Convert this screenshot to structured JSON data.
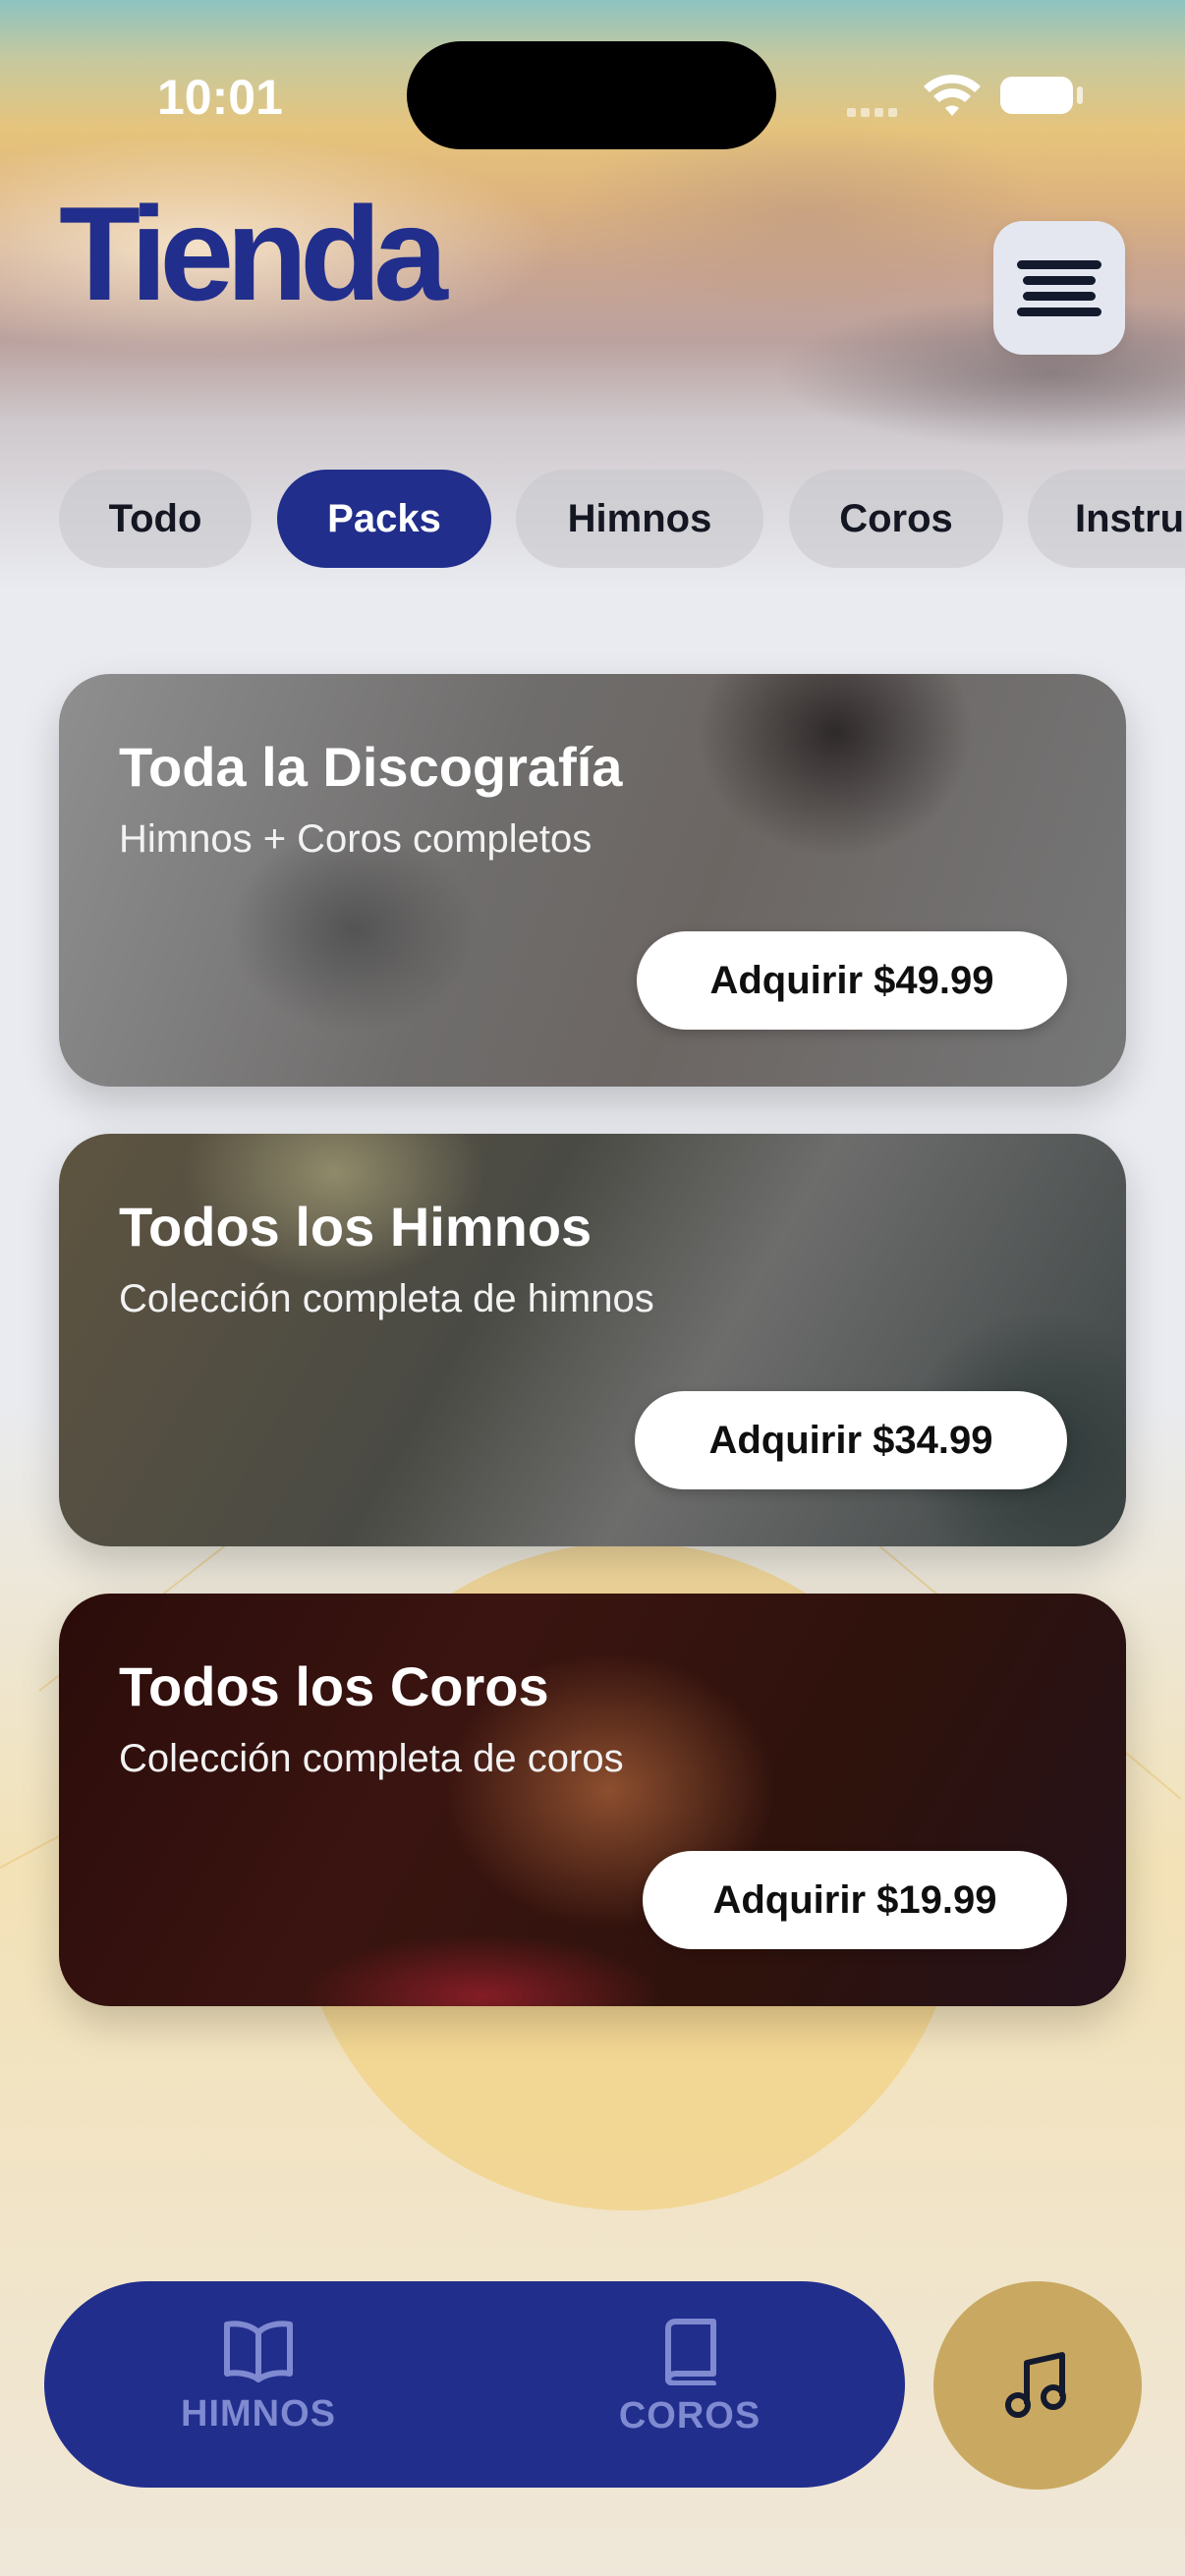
{
  "status": {
    "time": "10:01"
  },
  "header": {
    "title": "Tienda"
  },
  "tabs": [
    {
      "label": "Todo",
      "active": false
    },
    {
      "label": "Packs",
      "active": true
    },
    {
      "label": "Himnos",
      "active": false
    },
    {
      "label": "Coros",
      "active": false
    },
    {
      "label": "Instru",
      "active": false
    }
  ],
  "cards": [
    {
      "title": "Toda la Discografía",
      "subtitle": "Himnos + Coros completos",
      "button": "Adquirir $49.99"
    },
    {
      "title": "Todos los Himnos",
      "subtitle": "Colección completa de himnos",
      "button": "Adquirir $34.99"
    },
    {
      "title": "Todos los Coros",
      "subtitle": "Colección completa de coros",
      "button": "Adquirir $19.99"
    }
  ],
  "nav": {
    "himnos": {
      "label": "HIMNOS",
      "icon": "book-open-icon"
    },
    "coros": {
      "label": "COROS",
      "icon": "book-icon"
    },
    "music": {
      "icon": "music-note-icon"
    }
  },
  "colors": {
    "accent": "#212e8c",
    "gold": "#c9a961",
    "nav_inactive": "#7f8ad1"
  }
}
